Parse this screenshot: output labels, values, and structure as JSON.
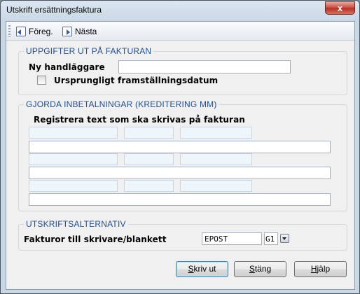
{
  "window": {
    "title": "Utskrift ersättningsfaktura",
    "close_label": "x"
  },
  "toolbar": {
    "items": [
      {
        "label": "Föreg.",
        "icon": "previous-page-icon"
      },
      {
        "label": "Nästa",
        "icon": "next-page-icon"
      }
    ]
  },
  "uppgifter": {
    "title": "UPPGIFTER UT PÅ FAKTURAN",
    "handlaggare_label": "Ny handläggare",
    "handlaggare_value": "",
    "checkbox_label": "Ursprungligt framställningsdatum",
    "checkbox_checked": false
  },
  "inbetalningar": {
    "title": "GJORDA INBETALNINGAR (KREDITERING MM)",
    "instruction": "Registrera text som ska skrivas på fakturan",
    "rows": [
      {
        "field1": "",
        "field2": "",
        "field3": "",
        "text": ""
      },
      {
        "field1": "",
        "field2": "",
        "field3": "",
        "text": ""
      },
      {
        "field1": "",
        "field2": "",
        "field3": "",
        "text": ""
      }
    ]
  },
  "utskrift": {
    "title": "UTSKRIFTSALTERNATIV",
    "fakturor_label": "Fakturor till skrivare/blankett",
    "printer_value": "EPOST",
    "form_value": "G1"
  },
  "buttons": {
    "print_prefix": "S",
    "print_rest": "kriv ut",
    "close_prefix": "S",
    "close_rest": "täng",
    "help_prefix": "H",
    "help_rest": "jälp"
  }
}
